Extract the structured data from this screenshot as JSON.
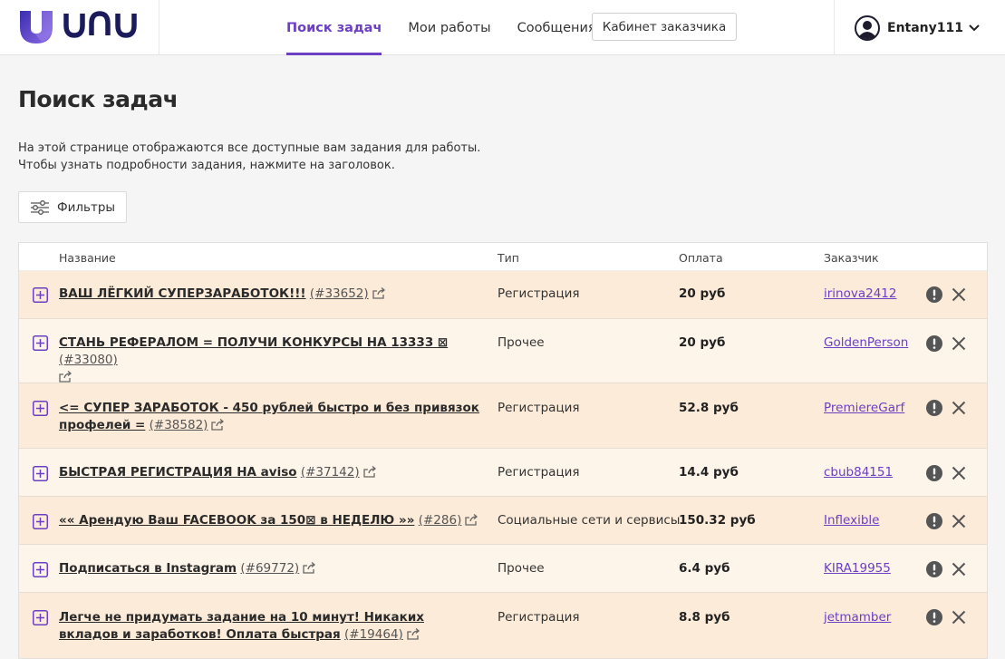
{
  "brand": {
    "logo_text": "unu"
  },
  "nav": {
    "items": [
      {
        "label": "Поиск задач",
        "active": true
      },
      {
        "label": "Мои работы",
        "active": false
      },
      {
        "label": "Сообщения",
        "active": false
      }
    ],
    "cabinet_button": "Кабинет заказчика"
  },
  "user": {
    "name": "Entany111"
  },
  "page": {
    "title": "Поиск задач",
    "intro_line1": "На этой странице отображаются все доступные вам задания для работы.",
    "intro_line2": "Чтобы узнать подробности задания, нажмите на заголовок.",
    "filters_label": "Фильтры"
  },
  "table": {
    "headers": {
      "name": "Название",
      "type": "Тип",
      "pay": "Оплата",
      "customer": "Заказчик"
    },
    "rows": [
      {
        "title": "ВАШ ЛЁГКИЙ СУПЕРЗАРАБОТОК!!!",
        "id": "(#33652)",
        "type": "Регистрация",
        "pay": "20 руб",
        "customer": "irinova2412"
      },
      {
        "title": "СТАНЬ РЕФЕРАЛОМ = ПОЛУЧИ КОНКУРСЫ НА 13333 ⊠",
        "id": "(#33080)",
        "type": "Прочее",
        "pay": "20 руб",
        "customer": "GoldenPerson"
      },
      {
        "title": "<= СУПЕР ЗАРАБОТОК - 450 рублей быстро и без привязок профелей =",
        "id": "(#38582)",
        "type": "Регистрация",
        "pay": "52.8 руб",
        "customer": "PremiereGarf"
      },
      {
        "title": "БЫСТРАЯ РЕГИСТРАЦИЯ НА aviso",
        "id": "(#37142)",
        "type": "Регистрация",
        "pay": "14.4 руб",
        "customer": "cbub84151"
      },
      {
        "title": "«« Арендую Ваш FACEBOOK за 150⊠ в НЕДЕЛЮ »»",
        "id": "(#286)",
        "type": "Социальные сети и сервисы",
        "pay": "150.32 руб",
        "customer": "Inflexible"
      },
      {
        "title": "Подписаться в Instagram",
        "id": "(#69772)",
        "type": "Прочее",
        "pay": "6.4 руб",
        "customer": "KIRA19955"
      },
      {
        "title": "Легче не придумать задание на 10 минут! Никаких вкладов и заработков! Оплата быстрая",
        "id": "(#19464)",
        "type": "Регистрация",
        "pay": "8.8 руб",
        "customer": "jetmamber"
      }
    ]
  }
}
